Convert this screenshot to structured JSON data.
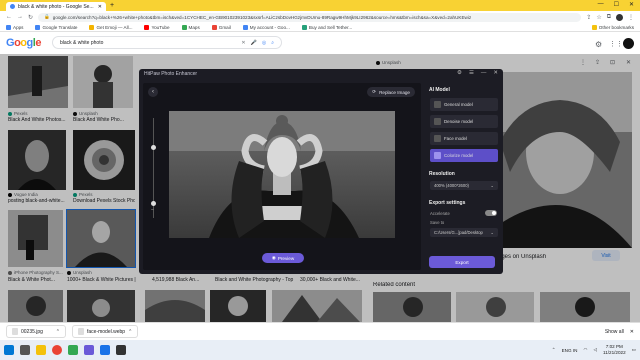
{
  "browser": {
    "tab_title": "black & white photo - Google Se...",
    "url": "google.com/search?q=black+%26+white+photo&tbm=isch&ved=1CYCHEC_en-GB90102391023&sxsrf=ALiCzsbDovHGzjmvDUmu-89Ragw9HhMjk9LI2962&source=hms&tbm=isch&sa=X&ved=2ahUKEwiz",
    "bookmarks": [
      "Apps",
      "Google Translate",
      "Get Emoji — All...",
      "YouTube",
      "Maps",
      "Gmail",
      "My account - Goo...",
      "Buy and Sell Tether..."
    ],
    "other_bookmarks": "Other bookmarks",
    "colors": {
      "tabbar": "#f8d233",
      "accent": "#6b5ad8"
    }
  },
  "google": {
    "logo": "Google",
    "query": "black & white photo"
  },
  "results": {
    "row1": [
      {
        "source": "Pexels",
        "caption": "Black And White Photos..."
      },
      {
        "source": "Unsplash",
        "caption": "Black And White Pho..."
      }
    ],
    "row2": [
      {
        "source": "Vogue India",
        "caption": "posting black-and-white..."
      },
      {
        "source": "Pexels",
        "caption": "Download Pexels Stock Pho..."
      }
    ],
    "row3": [
      {
        "source": "iPhone Photography S...",
        "caption": "Black & White Phot..."
      },
      {
        "source": "Unsplash",
        "caption": "1000+ Black & White Pictures | Do..."
      },
      {
        "caption": "4,519,988 Black An..."
      },
      {
        "caption": "Black and White Photography - Top 1..."
      },
      {
        "caption": "30,000+ Black and White..."
      }
    ]
  },
  "preview": {
    "source": "Unsplash",
    "title_tail": "ages on Unsplash",
    "visit_label": "Visit",
    "related": "Related content"
  },
  "modal": {
    "title": "HitPaw Photo Enhancer",
    "replace_label": "Replace Image",
    "preview_label": "Preview",
    "ai_model_title": "AI Model",
    "models": [
      "General model",
      "Denoise model",
      "Face model",
      "Colorize model"
    ],
    "active_model_index": 3,
    "resolution_title": "Resolution",
    "resolution_value": "400% (4000*2600)",
    "export_title": "Export settings",
    "accelerate_label": "Accelerate",
    "accelerate_on": true,
    "save_to_label": "Save to",
    "save_to_value": "C:/Users/G...]pad/Desktop",
    "export_label": "Export",
    "zoom_minus": "−"
  },
  "downloads": [
    {
      "name": "00235.jpg"
    },
    {
      "name": "face-model.webp"
    }
  ],
  "show_all": "Show all",
  "taskbar": {
    "lang": "ENG\nIN",
    "time": "7:02 PM",
    "date": "11/21/2022"
  }
}
